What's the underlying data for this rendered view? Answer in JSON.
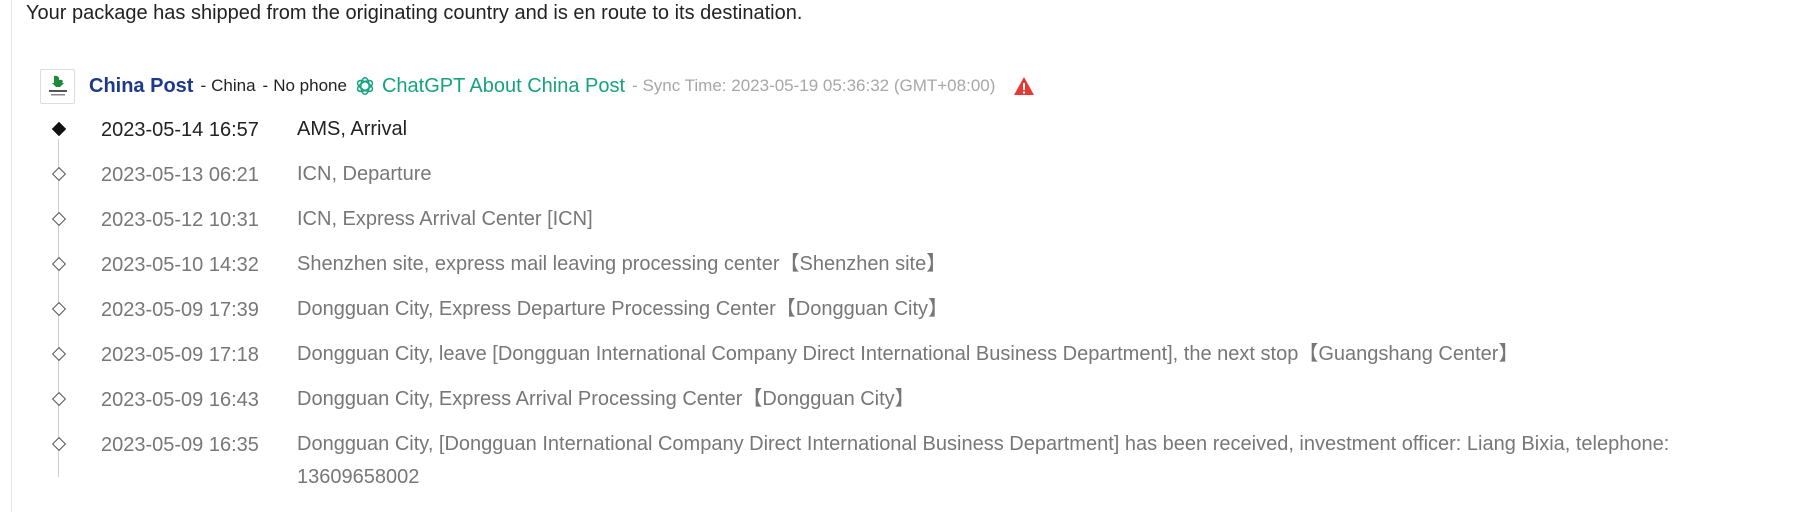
{
  "status_message": "Your package has shipped from the originating country and is en route to its destination.",
  "carrier": {
    "name": "China Post",
    "country": "China",
    "phone": "No phone",
    "chatgpt_label": "ChatGPT About China Post",
    "sync_text": "- Sync Time: 2023-05-19 05:36:32 (GMT+08:00)",
    "separator": "-",
    "colors": {
      "name": "#1d3a8a",
      "chatgpt": "#15a37e",
      "warning": "#e53935"
    }
  },
  "events": [
    {
      "time": "2023-05-14 16:57",
      "desc": "AMS, Arrival"
    },
    {
      "time": "2023-05-13 06:21",
      "desc": "ICN, Departure"
    },
    {
      "time": "2023-05-12 10:31",
      "desc": "ICN, Express Arrival Center [ICN]"
    },
    {
      "time": "2023-05-10 14:32",
      "desc": "Shenzhen site, express mail leaving processing center【Shenzhen site】"
    },
    {
      "time": "2023-05-09 17:39",
      "desc": "Dongguan City, Express Departure Processing Center【Dongguan City】"
    },
    {
      "time": "2023-05-09 17:18",
      "desc": "Dongguan City, leave [Dongguan International Company Direct International Business Department], the next stop【Guangshang Center】"
    },
    {
      "time": "2023-05-09 16:43",
      "desc": "Dongguan City, Express Arrival Processing Center【Dongguan City】"
    },
    {
      "time": "2023-05-09 16:35",
      "desc": "Dongguan City, [Dongguan International Company Direct International Business Department] has been received, investment officer: Liang Bixia, telephone: 13609658002"
    }
  ]
}
